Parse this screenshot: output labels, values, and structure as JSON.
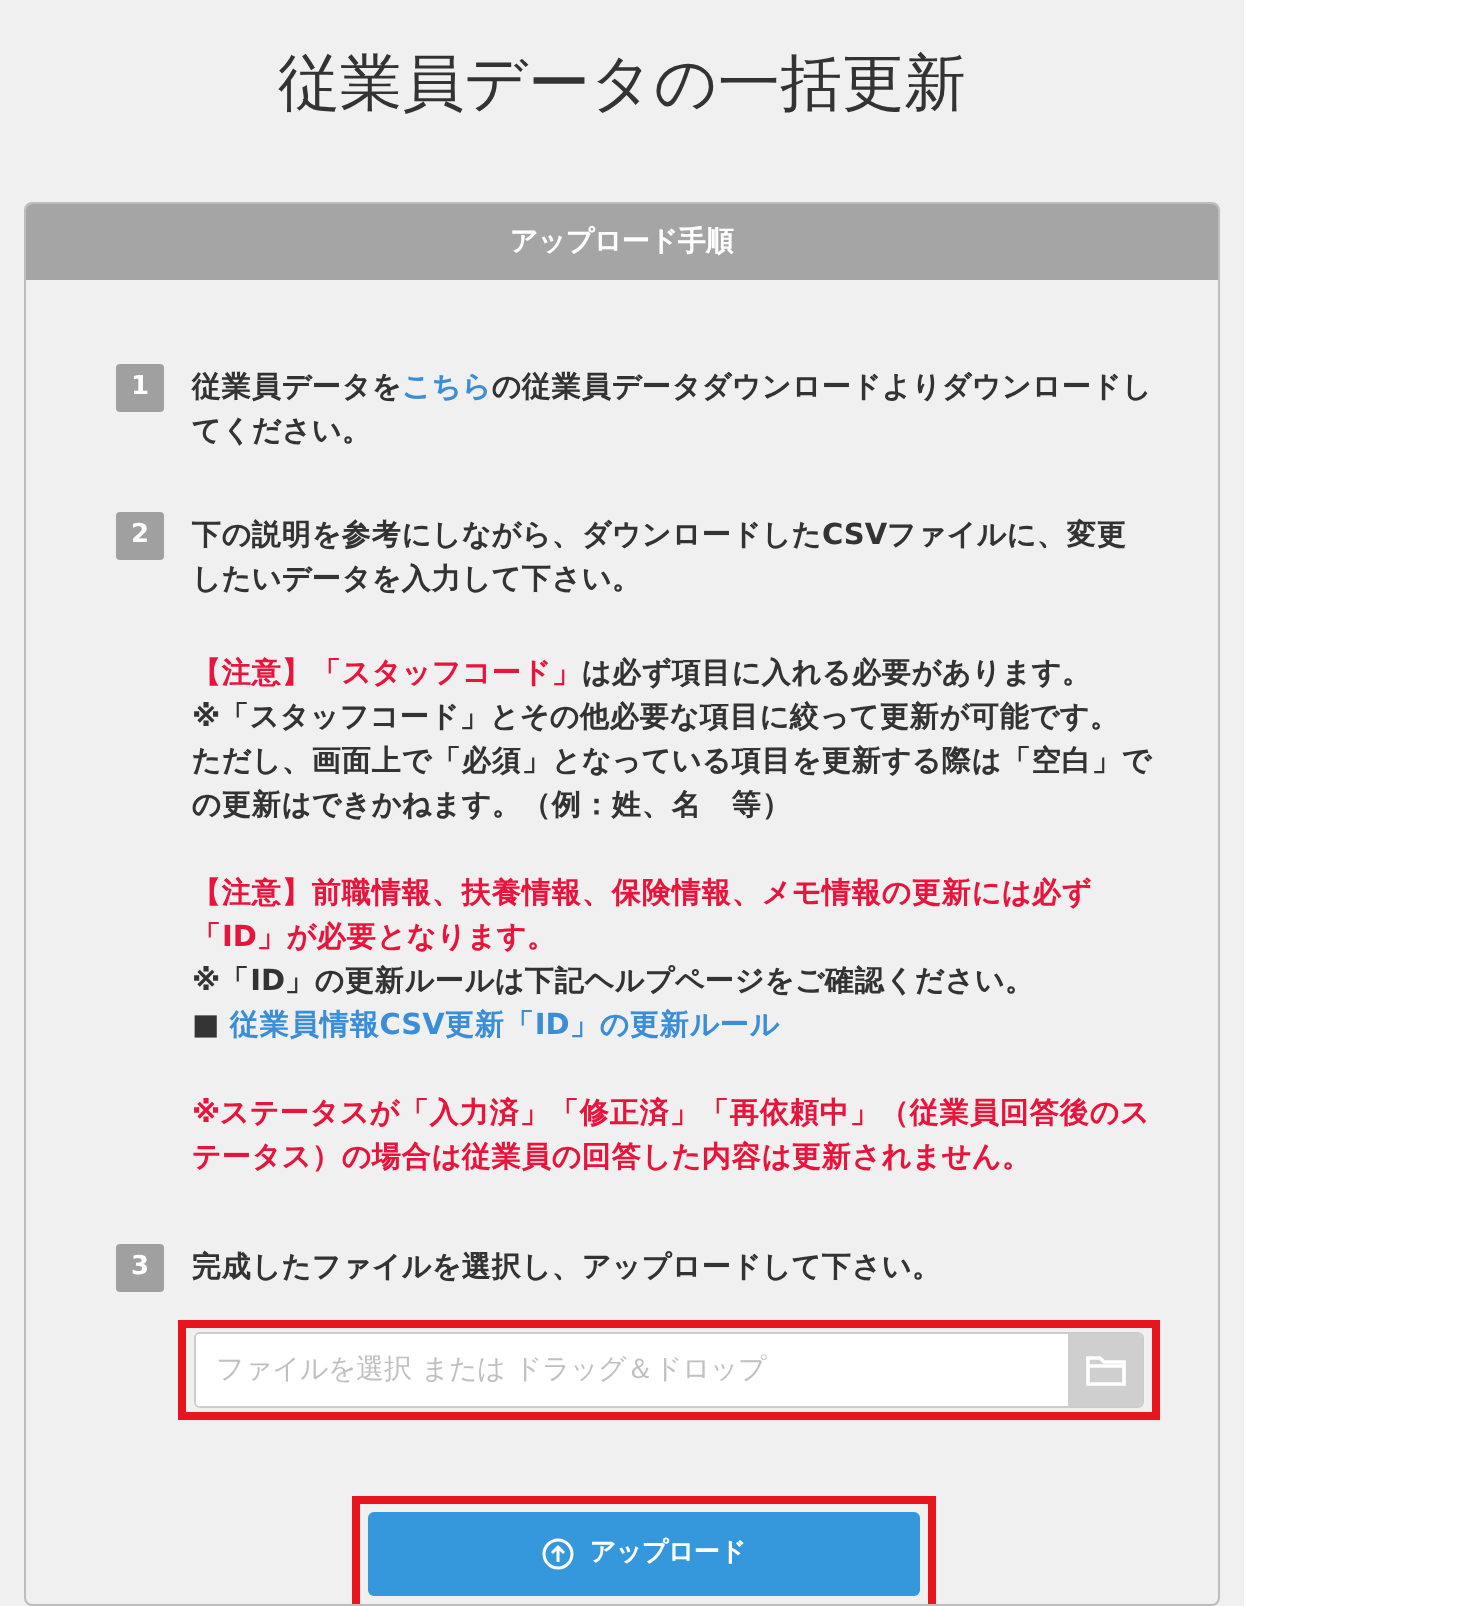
{
  "title": "従業員データの一括更新",
  "card": {
    "header": "アップロード手順",
    "steps": [
      {
        "number": "1",
        "segments": [
          {
            "kind": "text",
            "text": "従業員データを"
          },
          {
            "kind": "link",
            "text": "こちら"
          },
          {
            "kind": "text",
            "text": "の従業員データダウンロードよりダウンロードしてください。"
          }
        ]
      },
      {
        "number": "2",
        "segments": [
          {
            "kind": "text",
            "text": "下の説明を参考にしながら、ダウンロードしたCSVファイルに、変更したいデータを入力して下さい。"
          }
        ],
        "notes": [
          [
            [
              {
                "kind": "warning",
                "text": "【注意】「スタッフコード」"
              },
              {
                "kind": "text",
                "text": "は必ず項目に入れる必要があります。"
              }
            ],
            [
              {
                "kind": "text",
                "text": "※「スタッフコード」とその他必要な項目に絞って更新が可能です。"
              }
            ],
            [
              {
                "kind": "text",
                "text": "ただし、画面上で「必須」となっている項目を更新する際は「空白」での更新はできかねます。（例：姓、名　等）"
              }
            ]
          ],
          [
            [
              {
                "kind": "warning",
                "text": "【注意】前職情報、扶養情報、保険情報、メモ情報の更新には必ず「ID」が必要となります。"
              }
            ],
            [
              {
                "kind": "text",
                "text": "※「ID」の更新ルールは下記ヘルプページをご確認ください。"
              }
            ],
            [
              {
                "kind": "text",
                "text": "■ "
              },
              {
                "kind": "link",
                "text": "従業員情報CSV更新「ID」の更新ルール"
              }
            ]
          ],
          [
            [
              {
                "kind": "warning",
                "text": "※ステータスが「入力済」「修正済」「再依頼中」（従業員回答後のステータス）の場合は従業員の回答した内容は更新されません。"
              }
            ]
          ]
        ]
      },
      {
        "number": "3",
        "segments": [
          {
            "kind": "text",
            "text": "完成したファイルを選択し、アップロードして下さい。"
          }
        ]
      }
    ],
    "file_field": {
      "placeholder": "ファイルを選択 または ドラッグ＆ドロップ"
    },
    "upload_button": "アップロード"
  }
}
